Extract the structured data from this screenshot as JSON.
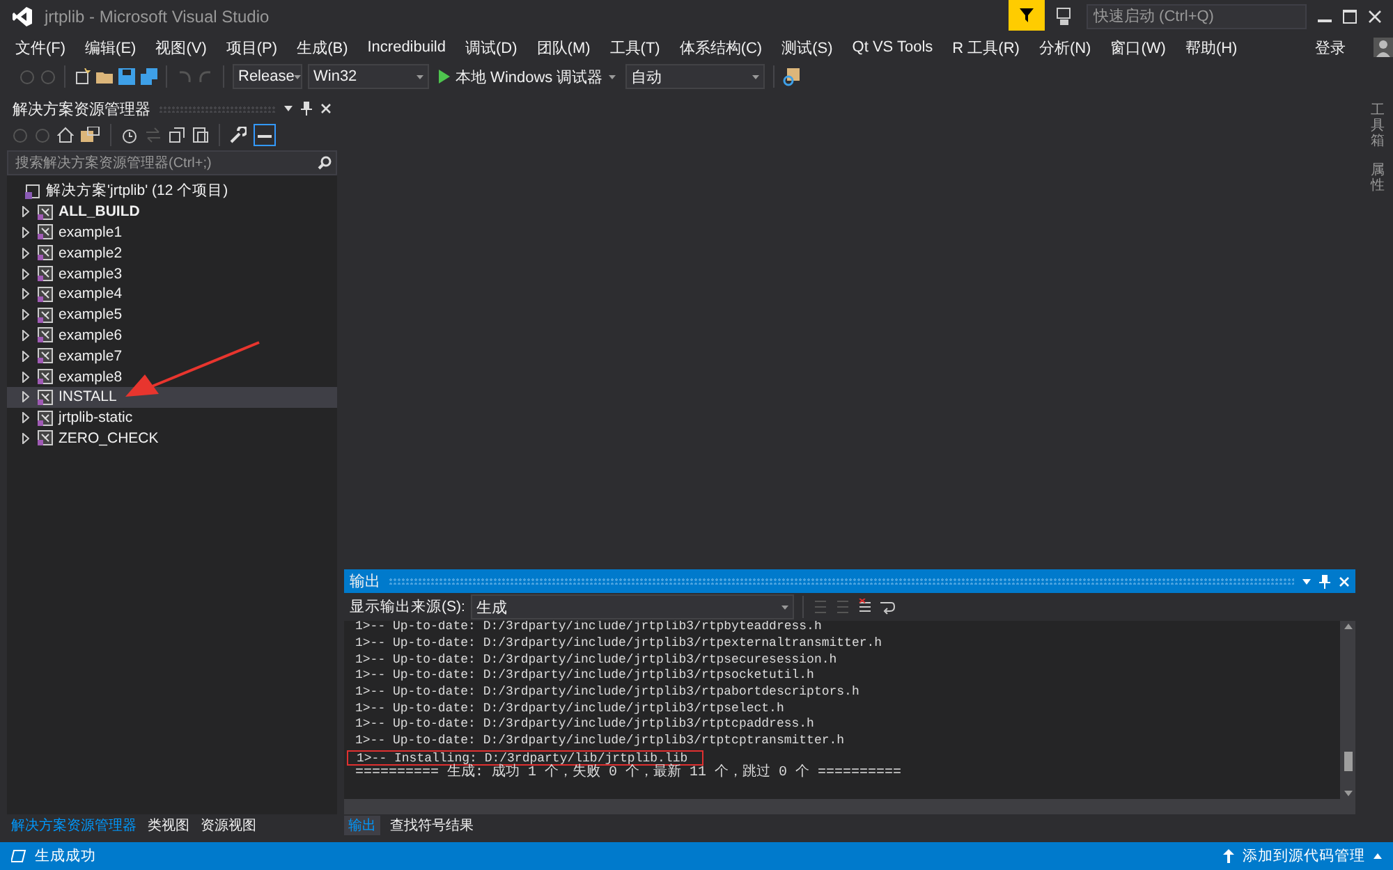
{
  "window": {
    "title": "jrtplib - Microsoft Visual Studio"
  },
  "quick_launch": {
    "placeholder": "快速启动 (Ctrl+Q)"
  },
  "menu": [
    "文件(F)",
    "编辑(E)",
    "视图(V)",
    "项目(P)",
    "生成(B)",
    "Incredibuild",
    "调试(D)",
    "团队(M)",
    "工具(T)",
    "体系结构(C)",
    "测试(S)",
    "Qt VS Tools",
    "R 工具(R)",
    "分析(N)",
    "窗口(W)",
    "帮助(H)"
  ],
  "login": "登录",
  "toolbar": {
    "configuration": "Release",
    "platform": "Win32",
    "debugger": "本地 Windows 调试器",
    "mode": "自动"
  },
  "solution_explorer": {
    "title": "解决方案资源管理器",
    "search": {
      "placeholder": "搜索解决方案资源管理器(Ctrl+;)"
    },
    "solution": "解决方案'jrtplib' (12 个项目)",
    "projects": [
      {
        "name": "ALL_BUILD",
        "startup": true,
        "selected": false,
        "marked": false
      },
      {
        "name": "example1",
        "startup": false,
        "selected": false,
        "marked": false
      },
      {
        "name": "example2",
        "startup": false,
        "selected": false,
        "marked": false
      },
      {
        "name": "example3",
        "startup": false,
        "selected": false,
        "marked": false
      },
      {
        "name": "example4",
        "startup": false,
        "selected": false,
        "marked": false
      },
      {
        "name": "example5",
        "startup": false,
        "selected": false,
        "marked": false
      },
      {
        "name": "example6",
        "startup": false,
        "selected": false,
        "marked": false
      },
      {
        "name": "example7",
        "startup": false,
        "selected": false,
        "marked": false
      },
      {
        "name": "example8",
        "startup": false,
        "selected": false,
        "marked": false
      },
      {
        "name": "INSTALL",
        "startup": false,
        "selected": true,
        "marked": true
      },
      {
        "name": "jrtplib-static",
        "startup": false,
        "selected": false,
        "marked": false
      },
      {
        "name": "ZERO_CHECK",
        "startup": false,
        "selected": false,
        "marked": false
      }
    ],
    "tabs": [
      {
        "label": "解决方案资源管理器",
        "selected": true
      },
      {
        "label": "类视图",
        "selected": false
      },
      {
        "label": "资源视图",
        "selected": false
      }
    ]
  },
  "side_tabs": [
    "工具箱",
    "属性"
  ],
  "output": {
    "title": "输出",
    "source_label": "显示输出来源(S):",
    "source": "生成",
    "lines": [
      {
        "text": "1>-- Up-to-date: D:/3rdparty/include/jrtplib3/rtpbyteaddress.h",
        "boxed": false
      },
      {
        "text": "1>-- Up-to-date: D:/3rdparty/include/jrtplib3/rtpexternaltransmitter.h",
        "boxed": false
      },
      {
        "text": "1>-- Up-to-date: D:/3rdparty/include/jrtplib3/rtpsecuresession.h",
        "boxed": false
      },
      {
        "text": "1>-- Up-to-date: D:/3rdparty/include/jrtplib3/rtpsocketutil.h",
        "boxed": false
      },
      {
        "text": "1>-- Up-to-date: D:/3rdparty/include/jrtplib3/rtpabortdescriptors.h",
        "boxed": false
      },
      {
        "text": "1>-- Up-to-date: D:/3rdparty/include/jrtplib3/rtpselect.h",
        "boxed": false
      },
      {
        "text": "1>-- Up-to-date: D:/3rdparty/include/jrtplib3/rtptcpaddress.h",
        "boxed": false
      },
      {
        "text": "1>-- Up-to-date: D:/3rdparty/include/jrtplib3/rtptcptransmitter.h",
        "boxed": false
      },
      {
        "text": "1>-- Installing: D:/3rdparty/lib/jrtplib.lib",
        "boxed": true
      },
      {
        "text": "========== 生成: 成功 1 个，失败 0 个，最新 11 个，跳过 0 个 ==========",
        "boxed": false
      }
    ],
    "tabs": [
      {
        "label": "输出",
        "selected": true
      },
      {
        "label": "查找符号结果",
        "selected": false
      }
    ]
  },
  "status_bar": {
    "message": "生成成功",
    "source_control": "添加到源代码管理"
  }
}
